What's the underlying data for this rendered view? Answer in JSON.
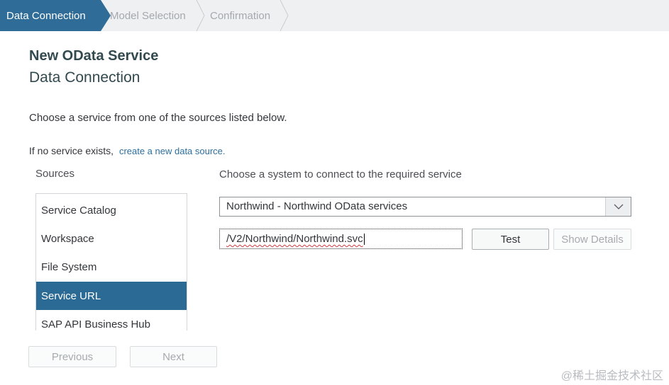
{
  "wizard": {
    "steps": [
      {
        "label": "Data Connection",
        "active": true
      },
      {
        "label": "Model Selection",
        "active": false
      },
      {
        "label": "Confirmation",
        "active": false
      }
    ]
  },
  "page": {
    "title": "New OData Service",
    "subtitle": "Data Connection",
    "instruction": "Choose a service from one of the sources listed below.",
    "no_service_text": "If no service exists,",
    "create_link": "create a new data source."
  },
  "sources": {
    "label": "Sources",
    "items": [
      {
        "label": "Service Catalog",
        "selected": false
      },
      {
        "label": "Workspace",
        "selected": false
      },
      {
        "label": "File System",
        "selected": false
      },
      {
        "label": "Service URL",
        "selected": true
      },
      {
        "label": "SAP API Business Hub",
        "selected": false
      }
    ]
  },
  "system": {
    "label": "Choose a system to connect to the required service",
    "selected": "Northwind - Northwind OData services",
    "url_value": "/V2/Northwind/Northwind.svc"
  },
  "buttons": {
    "test": "Test",
    "show_details": "Show Details",
    "previous": "Previous",
    "next": "Next"
  },
  "watermark": "@稀土掘金技术社区",
  "colors": {
    "accent": "#2f6c97",
    "selected_item": "#2b6a94",
    "link": "#2c6e9d"
  }
}
